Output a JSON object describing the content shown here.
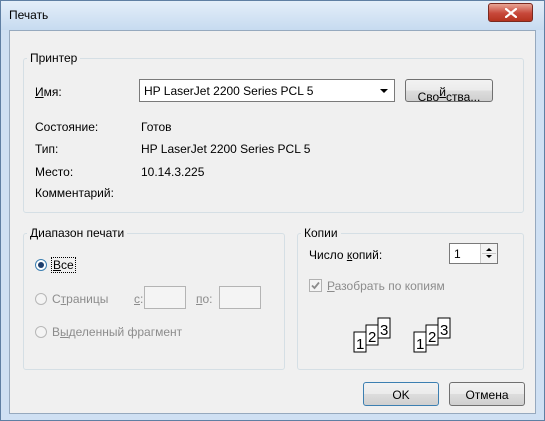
{
  "window": {
    "title": "Печать"
  },
  "printer": {
    "group_label": "Принтер",
    "name_label_u": "И",
    "name_label_rest": "мя:",
    "selected_printer": "HP LaserJet 2200 Series PCL 5",
    "properties_pre": "Сво",
    "properties_u": "й",
    "properties_post": "ства...",
    "status_label": "Состояние:",
    "status_value": "Готов",
    "type_label": "Тип:",
    "type_value": "HP LaserJet 2200 Series PCL 5",
    "location_label": "Место:",
    "location_value": "10.14.3.225",
    "comment_label": "Комментарий:",
    "comment_value": ""
  },
  "range": {
    "group_label": "Диапазон печати",
    "all_u": "В",
    "all_rest": "се",
    "all_selected": true,
    "pages_u": "т",
    "pages_pre": "С",
    "pages_post": "раницы",
    "from_u": "с",
    "to_u": "п",
    "to_rest": "о:",
    "selection_pre": "В",
    "selection_u": "ы",
    "selection_post": "деленный фрагмент"
  },
  "copies": {
    "group_label": "Копии",
    "count_label_pre": "Число ",
    "count_label_u": "к",
    "count_label_post": "опий:",
    "count_value": "1",
    "collate_u": "Р",
    "collate_rest": "азобрать по копиям",
    "collate_checked": true,
    "collate_digits": [
      "1",
      "2",
      "3"
    ]
  },
  "buttons": {
    "ok": "OK",
    "cancel": "Отмена"
  }
}
